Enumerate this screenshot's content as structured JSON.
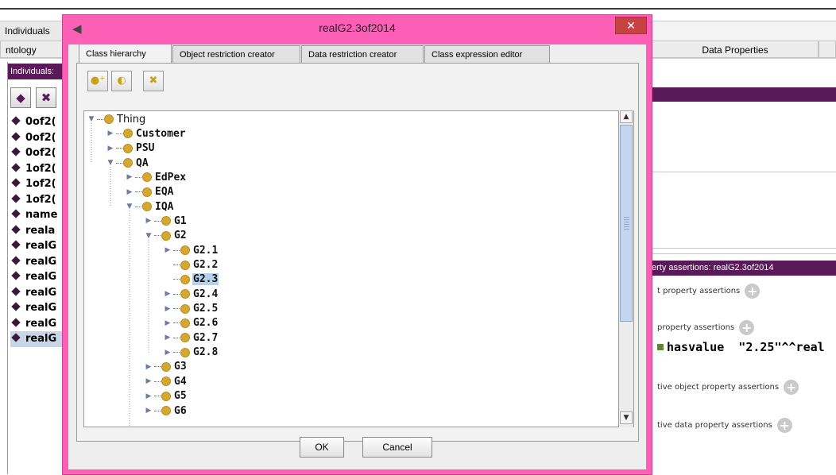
{
  "app": {
    "tabs": [
      "Individuals"
    ],
    "subtabs": [
      "ntology",
      "Data Properties"
    ],
    "left_panel_header": "Individuals:",
    "individuals": [
      "0of2(",
      "0of2(",
      "0of2(",
      "1of2(",
      "1of2(",
      "1of2(",
      "name",
      "reala",
      "realG",
      "realG",
      "realG",
      "realG",
      "realG",
      "realG",
      "realG"
    ]
  },
  "right_panel": {
    "header": "erty assertions: realG2.3of2014",
    "object_assertions_label": "t property assertions",
    "data_assertions_label": "property assertions",
    "hasvalue_text": "hasvalue  \"2.25\"^^real",
    "neg_object_label": "tive object property assertions",
    "neg_data_label": "tive data property assertions"
  },
  "dialog": {
    "title": "realG2.3of2014",
    "close_label": "✕",
    "tabs": [
      "Class hierarchy",
      "Object restriction creator",
      "Data restriction creator",
      "Class expression editor"
    ],
    "ok_label": "OK",
    "cancel_label": "Cancel"
  },
  "tree": {
    "nodes": [
      {
        "label": "Thing",
        "depth": 0,
        "expanded": true
      },
      {
        "label": "Customer",
        "depth": 1,
        "expanded": false
      },
      {
        "label": "PSU",
        "depth": 1,
        "expanded": false
      },
      {
        "label": "QA",
        "depth": 1,
        "expanded": true
      },
      {
        "label": "EdPex",
        "depth": 2,
        "expanded": false
      },
      {
        "label": "EQA",
        "depth": 2,
        "expanded": false
      },
      {
        "label": "IQA",
        "depth": 2,
        "expanded": true
      },
      {
        "label": "G1",
        "depth": 3,
        "expanded": false
      },
      {
        "label": "G2",
        "depth": 3,
        "expanded": true
      },
      {
        "label": "G2.1",
        "depth": 4,
        "expanded": false
      },
      {
        "label": "G2.2",
        "depth": 4,
        "leaf": true
      },
      {
        "label": "G2.3",
        "depth": 4,
        "leaf": true,
        "selected": true
      },
      {
        "label": "G2.4",
        "depth": 4,
        "expanded": false
      },
      {
        "label": "G2.5",
        "depth": 4,
        "expanded": false
      },
      {
        "label": "G2.6",
        "depth": 4,
        "expanded": false
      },
      {
        "label": "G2.7",
        "depth": 4,
        "expanded": false
      },
      {
        "label": "G2.8",
        "depth": 4,
        "expanded": false
      },
      {
        "label": "G3",
        "depth": 3,
        "expanded": false
      },
      {
        "label": "G4",
        "depth": 3,
        "expanded": false
      },
      {
        "label": "G5",
        "depth": 3,
        "expanded": false
      },
      {
        "label": "G6",
        "depth": 3,
        "expanded": false
      }
    ]
  },
  "colors": {
    "dialog_frame": "#fc5fb5",
    "header_purple": "#5a1a5a",
    "class_ball": "#d6a832",
    "selection": "#b8cfe9"
  }
}
